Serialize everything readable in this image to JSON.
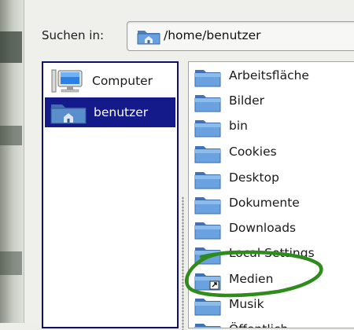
{
  "dialog": {
    "search_label": "Suchen in:",
    "location_path": "/home/benutzer"
  },
  "places": [
    {
      "label": "Computer",
      "icon": "computer-icon",
      "selected": false
    },
    {
      "label": "benutzer",
      "icon": "home-folder-icon",
      "selected": true
    }
  ],
  "files": [
    {
      "label": "Arbeitsfläche",
      "icon": "folder-icon"
    },
    {
      "label": "Bilder",
      "icon": "folder-icon"
    },
    {
      "label": "bin",
      "icon": "folder-icon"
    },
    {
      "label": "Cookies",
      "icon": "folder-icon"
    },
    {
      "label": "Desktop",
      "icon": "folder-icon"
    },
    {
      "label": "Dokumente",
      "icon": "folder-icon"
    },
    {
      "label": "Downloads",
      "icon": "folder-icon"
    },
    {
      "label": "Local Settings",
      "icon": "folder-icon"
    },
    {
      "label": "Medien",
      "icon": "folder-link-icon"
    },
    {
      "label": "Musik",
      "icon": "folder-icon"
    },
    {
      "label": "Öffentlich",
      "icon": "folder-icon"
    }
  ],
  "colors": {
    "selection": "#151a8a",
    "folder_blue": "#5a8fd0",
    "annotation_green": "#2e8b1c"
  }
}
